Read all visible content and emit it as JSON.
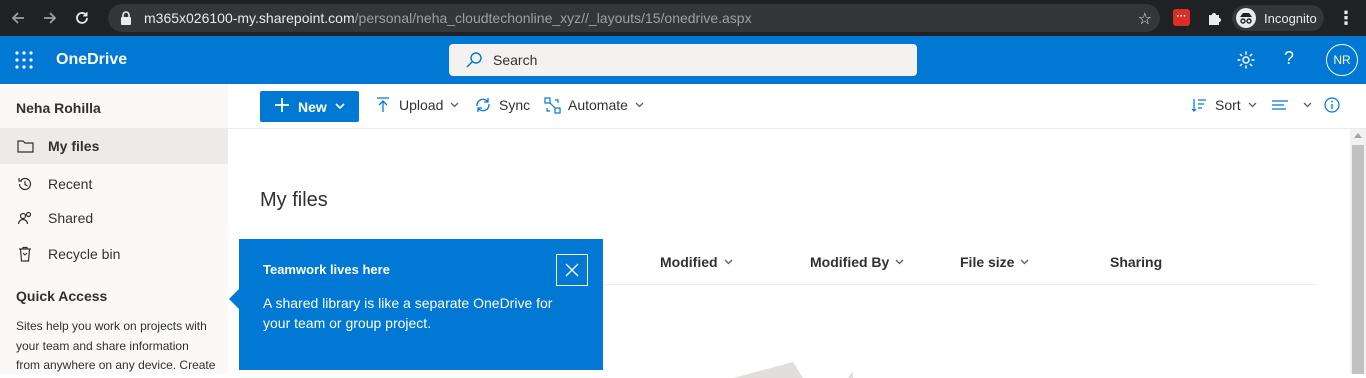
{
  "browser": {
    "url_host": "m365x026100-my.sharepoint.com",
    "url_path": "/personal/neha_cloudtechonline_xyz//_layouts/15/onedrive.aspx",
    "profile_label": "Incognito",
    "ext_label": "···"
  },
  "suite": {
    "brand": "OneDrive",
    "search_placeholder": "Search",
    "avatar_initials": "NR",
    "help_glyph": "?"
  },
  "leftnav": {
    "user_name": "Neha Rohilla",
    "items": [
      {
        "label": "My files",
        "icon": "folder-icon"
      },
      {
        "label": "Recent",
        "icon": "history-icon"
      },
      {
        "label": "Shared",
        "icon": "people-icon"
      },
      {
        "label": "Recycle bin",
        "icon": "recycle-bin-icon"
      }
    ],
    "quick_access_title": "Quick Access",
    "quick_access_text": "Sites help you work on projects with your team and share information from anywhere on any device. Create"
  },
  "commandbar": {
    "new_label": "New",
    "upload_label": "Upload",
    "sync_label": "Sync",
    "automate_label": "Automate",
    "sort_label": "Sort"
  },
  "content": {
    "title": "My files",
    "columns": [
      "Modified",
      "Modified By",
      "File size",
      "Sharing"
    ]
  },
  "callout": {
    "title": "Teamwork lives here",
    "body": "A shared library is like a separate OneDrive for your team or group project."
  },
  "colors": {
    "brand_blue": "#0078d4",
    "chrome_dark": "#202124"
  }
}
